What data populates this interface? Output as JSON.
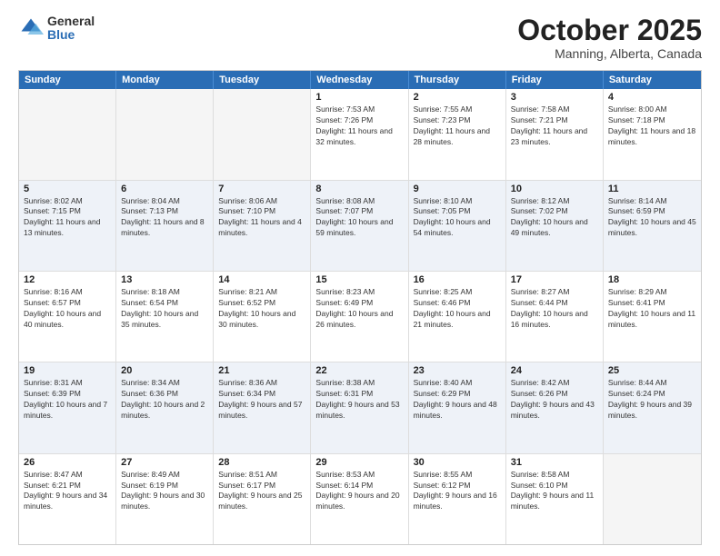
{
  "logo": {
    "general": "General",
    "blue": "Blue"
  },
  "header": {
    "month": "October 2025",
    "location": "Manning, Alberta, Canada"
  },
  "weekdays": [
    "Sunday",
    "Monday",
    "Tuesday",
    "Wednesday",
    "Thursday",
    "Friday",
    "Saturday"
  ],
  "weeks": [
    {
      "alt": false,
      "days": [
        {
          "num": "",
          "sunrise": "",
          "sunset": "",
          "daylight": ""
        },
        {
          "num": "",
          "sunrise": "",
          "sunset": "",
          "daylight": ""
        },
        {
          "num": "",
          "sunrise": "",
          "sunset": "",
          "daylight": ""
        },
        {
          "num": "1",
          "sunrise": "Sunrise: 7:53 AM",
          "sunset": "Sunset: 7:26 PM",
          "daylight": "Daylight: 11 hours and 32 minutes."
        },
        {
          "num": "2",
          "sunrise": "Sunrise: 7:55 AM",
          "sunset": "Sunset: 7:23 PM",
          "daylight": "Daylight: 11 hours and 28 minutes."
        },
        {
          "num": "3",
          "sunrise": "Sunrise: 7:58 AM",
          "sunset": "Sunset: 7:21 PM",
          "daylight": "Daylight: 11 hours and 23 minutes."
        },
        {
          "num": "4",
          "sunrise": "Sunrise: 8:00 AM",
          "sunset": "Sunset: 7:18 PM",
          "daylight": "Daylight: 11 hours and 18 minutes."
        }
      ]
    },
    {
      "alt": true,
      "days": [
        {
          "num": "5",
          "sunrise": "Sunrise: 8:02 AM",
          "sunset": "Sunset: 7:15 PM",
          "daylight": "Daylight: 11 hours and 13 minutes."
        },
        {
          "num": "6",
          "sunrise": "Sunrise: 8:04 AM",
          "sunset": "Sunset: 7:13 PM",
          "daylight": "Daylight: 11 hours and 8 minutes."
        },
        {
          "num": "7",
          "sunrise": "Sunrise: 8:06 AM",
          "sunset": "Sunset: 7:10 PM",
          "daylight": "Daylight: 11 hours and 4 minutes."
        },
        {
          "num": "8",
          "sunrise": "Sunrise: 8:08 AM",
          "sunset": "Sunset: 7:07 PM",
          "daylight": "Daylight: 10 hours and 59 minutes."
        },
        {
          "num": "9",
          "sunrise": "Sunrise: 8:10 AM",
          "sunset": "Sunset: 7:05 PM",
          "daylight": "Daylight: 10 hours and 54 minutes."
        },
        {
          "num": "10",
          "sunrise": "Sunrise: 8:12 AM",
          "sunset": "Sunset: 7:02 PM",
          "daylight": "Daylight: 10 hours and 49 minutes."
        },
        {
          "num": "11",
          "sunrise": "Sunrise: 8:14 AM",
          "sunset": "Sunset: 6:59 PM",
          "daylight": "Daylight: 10 hours and 45 minutes."
        }
      ]
    },
    {
      "alt": false,
      "days": [
        {
          "num": "12",
          "sunrise": "Sunrise: 8:16 AM",
          "sunset": "Sunset: 6:57 PM",
          "daylight": "Daylight: 10 hours and 40 minutes."
        },
        {
          "num": "13",
          "sunrise": "Sunrise: 8:18 AM",
          "sunset": "Sunset: 6:54 PM",
          "daylight": "Daylight: 10 hours and 35 minutes."
        },
        {
          "num": "14",
          "sunrise": "Sunrise: 8:21 AM",
          "sunset": "Sunset: 6:52 PM",
          "daylight": "Daylight: 10 hours and 30 minutes."
        },
        {
          "num": "15",
          "sunrise": "Sunrise: 8:23 AM",
          "sunset": "Sunset: 6:49 PM",
          "daylight": "Daylight: 10 hours and 26 minutes."
        },
        {
          "num": "16",
          "sunrise": "Sunrise: 8:25 AM",
          "sunset": "Sunset: 6:46 PM",
          "daylight": "Daylight: 10 hours and 21 minutes."
        },
        {
          "num": "17",
          "sunrise": "Sunrise: 8:27 AM",
          "sunset": "Sunset: 6:44 PM",
          "daylight": "Daylight: 10 hours and 16 minutes."
        },
        {
          "num": "18",
          "sunrise": "Sunrise: 8:29 AM",
          "sunset": "Sunset: 6:41 PM",
          "daylight": "Daylight: 10 hours and 11 minutes."
        }
      ]
    },
    {
      "alt": true,
      "days": [
        {
          "num": "19",
          "sunrise": "Sunrise: 8:31 AM",
          "sunset": "Sunset: 6:39 PM",
          "daylight": "Daylight: 10 hours and 7 minutes."
        },
        {
          "num": "20",
          "sunrise": "Sunrise: 8:34 AM",
          "sunset": "Sunset: 6:36 PM",
          "daylight": "Daylight: 10 hours and 2 minutes."
        },
        {
          "num": "21",
          "sunrise": "Sunrise: 8:36 AM",
          "sunset": "Sunset: 6:34 PM",
          "daylight": "Daylight: 9 hours and 57 minutes."
        },
        {
          "num": "22",
          "sunrise": "Sunrise: 8:38 AM",
          "sunset": "Sunset: 6:31 PM",
          "daylight": "Daylight: 9 hours and 53 minutes."
        },
        {
          "num": "23",
          "sunrise": "Sunrise: 8:40 AM",
          "sunset": "Sunset: 6:29 PM",
          "daylight": "Daylight: 9 hours and 48 minutes."
        },
        {
          "num": "24",
          "sunrise": "Sunrise: 8:42 AM",
          "sunset": "Sunset: 6:26 PM",
          "daylight": "Daylight: 9 hours and 43 minutes."
        },
        {
          "num": "25",
          "sunrise": "Sunrise: 8:44 AM",
          "sunset": "Sunset: 6:24 PM",
          "daylight": "Daylight: 9 hours and 39 minutes."
        }
      ]
    },
    {
      "alt": false,
      "days": [
        {
          "num": "26",
          "sunrise": "Sunrise: 8:47 AM",
          "sunset": "Sunset: 6:21 PM",
          "daylight": "Daylight: 9 hours and 34 minutes."
        },
        {
          "num": "27",
          "sunrise": "Sunrise: 8:49 AM",
          "sunset": "Sunset: 6:19 PM",
          "daylight": "Daylight: 9 hours and 30 minutes."
        },
        {
          "num": "28",
          "sunrise": "Sunrise: 8:51 AM",
          "sunset": "Sunset: 6:17 PM",
          "daylight": "Daylight: 9 hours and 25 minutes."
        },
        {
          "num": "29",
          "sunrise": "Sunrise: 8:53 AM",
          "sunset": "Sunset: 6:14 PM",
          "daylight": "Daylight: 9 hours and 20 minutes."
        },
        {
          "num": "30",
          "sunrise": "Sunrise: 8:55 AM",
          "sunset": "Sunset: 6:12 PM",
          "daylight": "Daylight: 9 hours and 16 minutes."
        },
        {
          "num": "31",
          "sunrise": "Sunrise: 8:58 AM",
          "sunset": "Sunset: 6:10 PM",
          "daylight": "Daylight: 9 hours and 11 minutes."
        },
        {
          "num": "",
          "sunrise": "",
          "sunset": "",
          "daylight": ""
        }
      ]
    }
  ]
}
